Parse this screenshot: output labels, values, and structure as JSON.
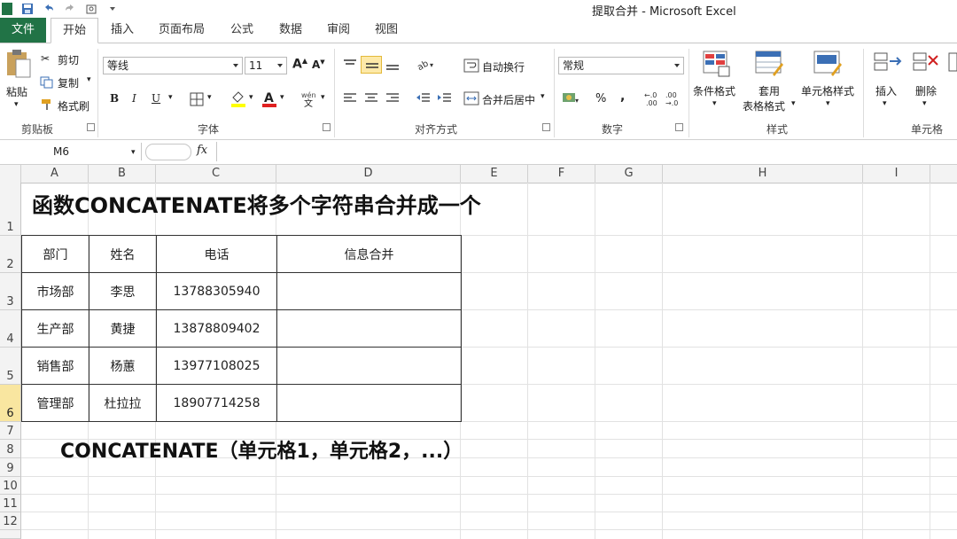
{
  "window": {
    "title": "提取合并 - Microsoft Excel"
  },
  "tabs": [
    "文件",
    "开始",
    "插入",
    "页面布局",
    "公式",
    "数据",
    "审阅",
    "视图"
  ],
  "ribbon": {
    "clipboard": {
      "paste": "粘贴",
      "cut": "剪切",
      "copy": "复制",
      "format_painter": "格式刷",
      "label": "剪贴板"
    },
    "font": {
      "family": "等线",
      "size": "11",
      "bold": "B",
      "italic": "I",
      "underline": "U",
      "label": "字体"
    },
    "alignment": {
      "wrap": "自动换行",
      "merge": "合并后居中",
      "label": "对齐方式"
    },
    "number": {
      "format": "常规",
      "percent": "%",
      "comma": ",",
      "label": "数字"
    },
    "styles": {
      "conditional": "条件格式",
      "table_fmt_1": "套用",
      "table_fmt_2": "表格格式",
      "cell_styles": "单元格样式",
      "label": "样式"
    },
    "cells": {
      "insert": "插入",
      "delete": "删除",
      "label": "单元格"
    }
  },
  "formula_bar": {
    "name_box": "M6",
    "fx": "fx",
    "content": ""
  },
  "columns": [
    "A",
    "B",
    "C",
    "D",
    "E",
    "F",
    "G",
    "H",
    "I"
  ],
  "rows": [
    "1",
    "2",
    "3",
    "4",
    "5",
    "6",
    "7",
    "8",
    "9",
    "10",
    "11",
    "12"
  ],
  "sheet": {
    "heading": "函数CONCATENATE将多个字符串合并成一个",
    "table": {
      "headers": [
        "部门",
        "姓名",
        "电话",
        "信息合并"
      ],
      "rows": [
        [
          "市场部",
          "李思",
          "13788305940",
          ""
        ],
        [
          "生产部",
          "黄捷",
          "13878809402",
          ""
        ],
        [
          "销售部",
          "杨蕙",
          "13977108025",
          ""
        ],
        [
          "管理部",
          "杜拉拉",
          "18907714258",
          ""
        ]
      ]
    },
    "syntax": "CONCATENATE（单元格1，单元格2，...）"
  },
  "colors": {
    "excel_green": "#217346",
    "selected_row": "#f9e6a0",
    "active_button": "#fde9a8"
  }
}
